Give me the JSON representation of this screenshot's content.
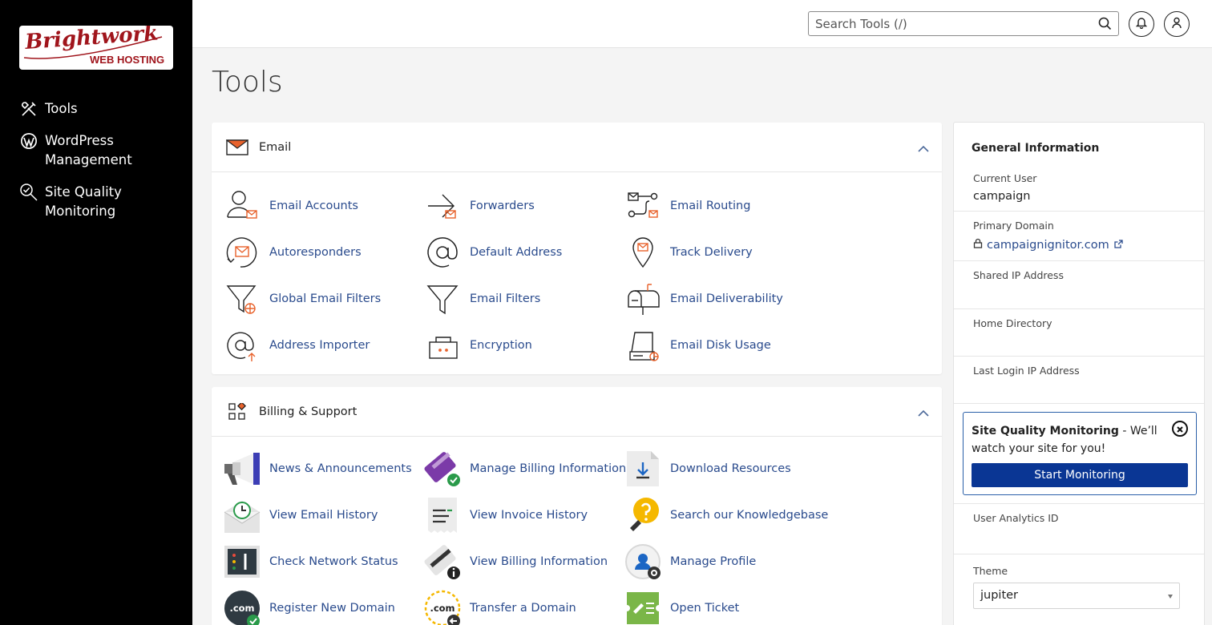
{
  "brand": {
    "logo_line1": "Brightwork",
    "logo_line2": "WEB HOSTING"
  },
  "sidebar": {
    "items": [
      {
        "label": "Tools",
        "icon": "tools-icon"
      },
      {
        "label": "WordPress Management",
        "icon": "wordpress-icon"
      },
      {
        "label": "Site Quality Monitoring",
        "icon": "site-quality-icon"
      }
    ]
  },
  "topbar": {
    "search_placeholder": "Search Tools (/)"
  },
  "page": {
    "title": "Tools"
  },
  "sections": {
    "email": {
      "title": "Email",
      "tools": [
        [
          "Email Accounts",
          "Forwarders",
          "Email Routing"
        ],
        [
          "Autoresponders",
          "Default Address",
          "Track Delivery"
        ],
        [
          "Global Email Filters",
          "Email Filters",
          "Email Deliverability"
        ],
        [
          "Address Importer",
          "Encryption",
          "Email Disk Usage"
        ]
      ]
    },
    "billing": {
      "title": "Billing & Support",
      "tools": [
        [
          "News & Announcements",
          "Manage Billing Information",
          "Download Resources"
        ],
        [
          "View Email History",
          "View Invoice History",
          "Search our Knowledgebase"
        ],
        [
          "Check Network Status",
          "View Billing Information",
          "Manage Profile"
        ],
        [
          "Register New Domain",
          "Transfer a Domain",
          "Open Ticket"
        ]
      ],
      "icon_text": {
        "domain_badge": ".com"
      }
    }
  },
  "info": {
    "title": "General Information",
    "current_user_label": "Current User",
    "current_user": "campaign",
    "primary_domain_label": "Primary Domain",
    "primary_domain": "campaignignitor.com",
    "shared_ip_label": "Shared IP Address",
    "home_dir_label": "Home Directory",
    "last_login_label": "Last Login IP Address",
    "sqm_title": "Site Quality Monitoring",
    "sqm_text": " - We’ll watch your site for you!",
    "sqm_button": "Start Monitoring",
    "analytics_label": "User Analytics ID",
    "theme_label": "Theme",
    "theme_value": "jupiter"
  },
  "colors": {
    "accent_orange": "#e8622c",
    "link_blue": "#2a4b8d",
    "button_blue": "#0a3694",
    "logo_red": "#a0151c"
  }
}
